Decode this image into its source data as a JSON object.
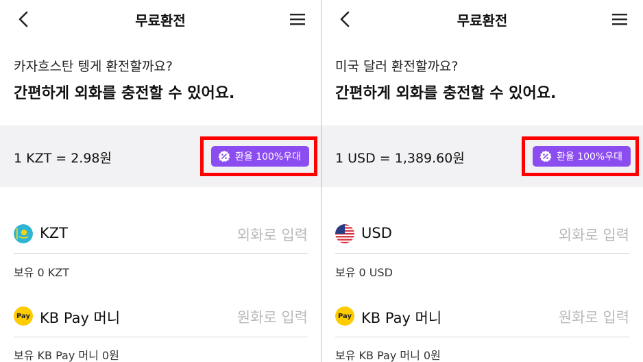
{
  "colors": {
    "accent": "#8b4cf0",
    "highlight": "#ff0000",
    "band": "#f2f2f4",
    "pay_yellow": "#ffcc00"
  },
  "panels": [
    {
      "header": {
        "title": "무료환전",
        "back_icon": "chevron-left-icon",
        "menu_icon": "hamburger-menu-icon"
      },
      "question": "카자흐스탄 텡게 환전할까요?",
      "headline": "간편하게 외화를 충전할 수 있어요.",
      "rate": "1 KZT = 2.98원",
      "benefit_label": "환율 100%우대",
      "currency": {
        "code": "KZT",
        "flag_icon": "kazakhstan-flag-icon",
        "placeholder": "외화로 입력",
        "holding": "보유 0 KZT"
      },
      "pay": {
        "icon_text": "Pay",
        "label": "KB Pay 머니",
        "placeholder": "원화로 입력",
        "holding": "보유 KB Pay 머니 0원"
      }
    },
    {
      "header": {
        "title": "무료환전",
        "back_icon": "chevron-left-icon",
        "menu_icon": "hamburger-menu-icon"
      },
      "question": "미국 달러 환전할까요?",
      "headline": "간편하게 외화를 충전할 수 있어요.",
      "rate": "1 USD = 1,389.60원",
      "benefit_label": "환율 100%우대",
      "currency": {
        "code": "USD",
        "flag_icon": "usa-flag-icon",
        "placeholder": "외화로 입력",
        "holding": "보유 0 USD"
      },
      "pay": {
        "icon_text": "Pay",
        "label": "KB Pay 머니",
        "placeholder": "원화로 입력",
        "holding": "보유 KB Pay 머니 0원"
      }
    }
  ]
}
